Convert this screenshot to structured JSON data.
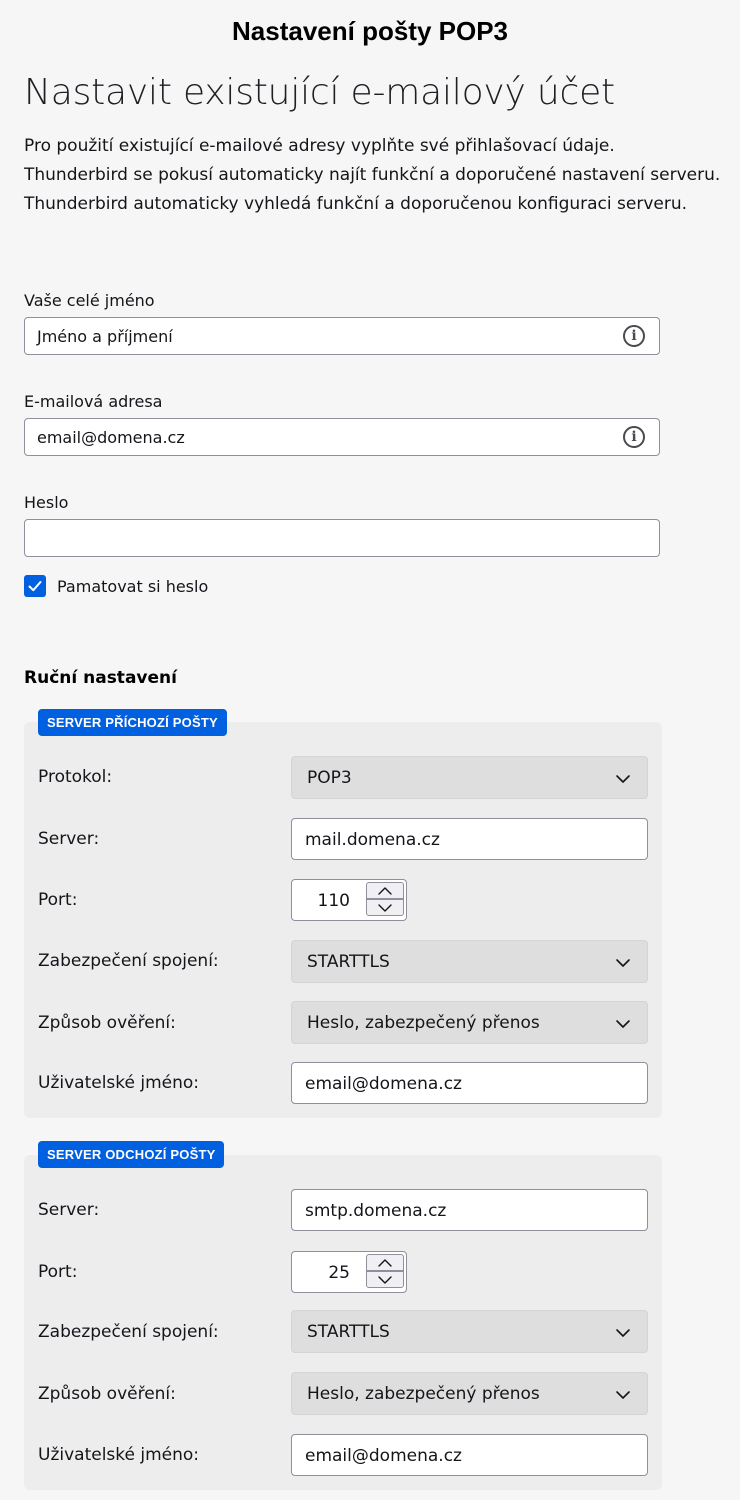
{
  "page_heading": "Nastavení pošty POP3",
  "main_title": "Nastavit existující e-mailový účet",
  "description": [
    "Pro použití existující e-mailové adresy vyplňte své přihlašovací údaje.",
    "Thunderbird se pokusí automaticky najít funkční a doporučené nastavení serveru.",
    "Thunderbird automaticky vyhledá funkční a doporučenou konfiguraci serveru."
  ],
  "form": {
    "name_label": "Vaše celé jméno",
    "name_value": "Jméno a příjmení",
    "email_label": "E-mailová adresa",
    "email_value": "email@domena.cz",
    "password_label": "Heslo",
    "password_value": "",
    "remember_label": "Pamatovat si heslo",
    "remember_checked": true
  },
  "manual_heading": "Ruční nastavení",
  "incoming": {
    "badge": "SERVER PŘÍCHOZÍ POŠTY",
    "protocol_label": "Protokol:",
    "protocol_value": "POP3",
    "server_label": "Server:",
    "server_value": "mail.domena.cz",
    "port_label": "Port:",
    "port_value": "110",
    "security_label": "Zabezpečení spojení:",
    "security_value": "STARTTLS",
    "auth_label": "Způsob ověření:",
    "auth_value": "Heslo, zabezpečený přenos",
    "username_label": "Uživatelské jméno:",
    "username_value": "email@domena.cz"
  },
  "outgoing": {
    "badge": "SERVER ODCHOZÍ POŠTY",
    "server_label": "Server:",
    "server_value": "smtp.domena.cz",
    "port_label": "Port:",
    "port_value": "25",
    "security_label": "Zabezpečení spojení:",
    "security_value": "STARTTLS",
    "auth_label": "Způsob ověření:",
    "auth_value": "Heslo, zabezpečený přenos",
    "username_label": "Uživatelské jméno:",
    "username_value": "email@domena.cz"
  },
  "icons": {
    "info": "info-icon",
    "check": "checkmark-icon",
    "chevron": "chevron-down-icon",
    "spin_up": "chevron-up-icon",
    "spin_down": "chevron-down-icon"
  },
  "colors": {
    "accent": "#0060df",
    "background": "#f6f6f6",
    "panel": "#ededed"
  }
}
